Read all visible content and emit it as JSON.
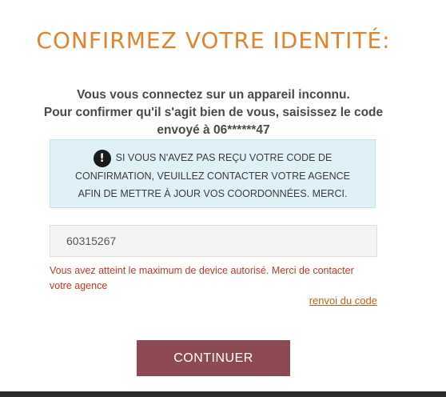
{
  "title": "CONFIRMEZ VOTRE IDENTITÉ:",
  "intro": {
    "line1": "Vous vous connectez sur un appareil inconnu.",
    "line2": "Pour confirmer qu'il s'agit bien de vous, saisissez le code",
    "line3": "envoyé à 06******47"
  },
  "info": {
    "icon": "exclamation-icon",
    "line1": "SI VOUS N'AVEZ PAS REÇU VOTRE CODE DE",
    "line2": "CONFIRMATION, VEUILLEZ CONTACTER VOTRE AGENCE",
    "line3": "AFIN DE METTRE À JOUR VOS COORDONNÉES. MERCI."
  },
  "code_input": {
    "value": "60315267"
  },
  "error": "Vous avez atteint le maximum de device autorisé. Merci de contacter votre agence",
  "resend_label": "renvoi du code",
  "continue_label": "CONTINUER",
  "colors": {
    "title": "#e0832f",
    "button": "#8d4a52",
    "error": "#c0392b",
    "info_bg": "#dff0f7"
  }
}
